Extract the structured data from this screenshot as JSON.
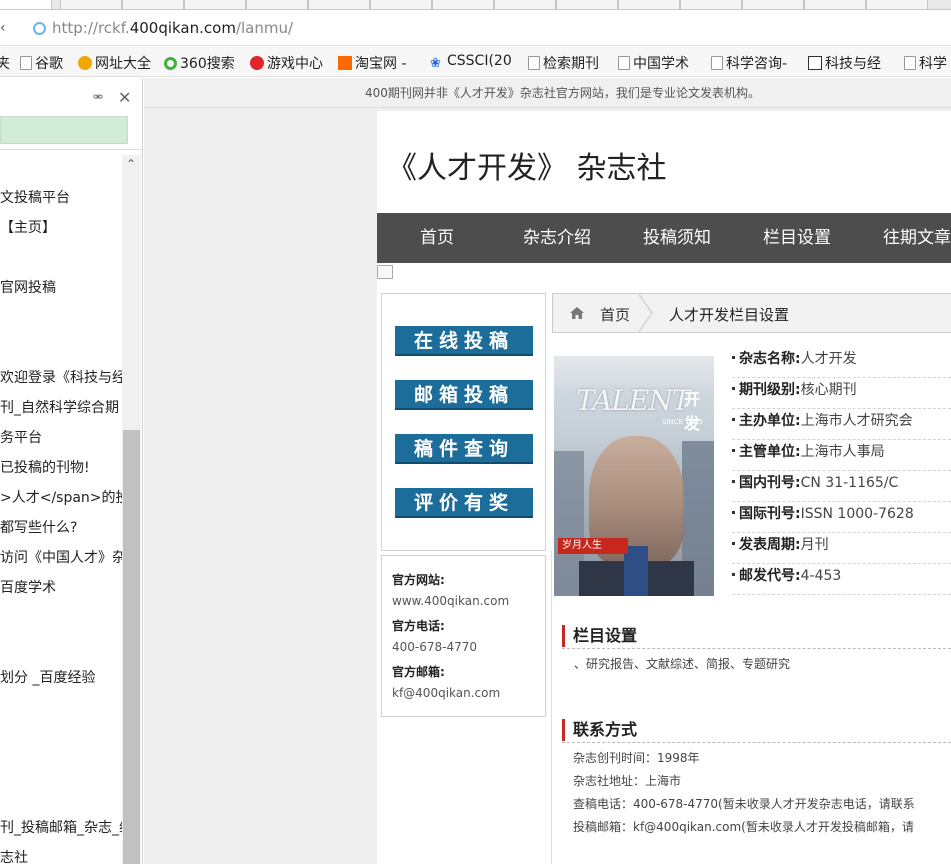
{
  "browser": {
    "address": {
      "prefix": "http://rckf.",
      "domain": "400qikan.com",
      "path": "/lanmu/"
    },
    "bookmarks": [
      {
        "label": "夹",
        "icon": "none"
      },
      {
        "label": "谷歌",
        "icon": "page-icon"
      },
      {
        "label": "网址大全",
        "icon": "hao123-icon"
      },
      {
        "label": "360搜索",
        "icon": "360-search-icon"
      },
      {
        "label": "游戏中心",
        "icon": "game-center-icon"
      },
      {
        "label": "淘宝网 -",
        "icon": "taobao-icon"
      },
      {
        "label": "CSSCI(20",
        "icon": "paw-icon"
      },
      {
        "label": "检索期刊",
        "icon": "page-icon"
      },
      {
        "label": "中国学术",
        "icon": "page-icon"
      },
      {
        "label": "科学咨询-",
        "icon": "page-icon"
      },
      {
        "label": "科技与经",
        "icon": "zhiwang-icon"
      },
      {
        "label": "科学",
        "icon": "page-icon"
      }
    ]
  },
  "sidebar": {
    "items": [
      "文投稿平台",
      "【主页】",
      "官网投稿",
      "欢迎登录《科技与经",
      "刊_自然科学综合期",
      "务平台",
      "已投稿的刊物!",
      ">人才</span>的投",
      "都写些什么?",
      "访问《中国人才》杂",
      "百度学术",
      "划分 _百度经验",
      "刊_投稿邮箱_杂志_组",
      "志社"
    ]
  },
  "page": {
    "notice": "400期刊网并非《人才开发》杂志社官方网站，我们是专业论文发表机构。",
    "title": "《人才开发》 杂志社",
    "nav": [
      "首页",
      "杂志介绍",
      "投稿须知",
      "栏目设置",
      "往期文章"
    ],
    "side_buttons": [
      "在线投稿",
      "邮箱投稿",
      "稿件查询",
      "评价有奖"
    ],
    "contact": {
      "website_label": "官方网站:",
      "website": "www.400qikan.com",
      "phone_label": "官方电话:",
      "phone": "400-678-4770",
      "email_label": "官方邮箱:",
      "email": "kf@400qikan.com"
    },
    "breadcrumb": {
      "home": "首页",
      "current": "人才开发栏目设置"
    },
    "cover": {
      "brand": "TALENT",
      "brand_cn": "开发",
      "since": "SINCE 1985",
      "banner": "岁月人生 "
    },
    "info": [
      {
        "label": "杂志名称:",
        "value": "人才开发"
      },
      {
        "label": "期刊级别:",
        "value": "核心期刊"
      },
      {
        "label": "主办单位:",
        "value": "上海市人才研究会"
      },
      {
        "label": "主管单位:",
        "value": "上海市人事局"
      },
      {
        "label": "国内刊号:",
        "value": "CN 31-1165/C"
      },
      {
        "label": "国际刊号:",
        "value": "ISSN 1000-7628"
      },
      {
        "label": "发表周期:",
        "value": "月刊"
      },
      {
        "label": "邮发代号:",
        "value": "4-453"
      }
    ],
    "columns_section": {
      "title": "栏目设置",
      "text": "、研究报告、文献综述、简报、专题研究"
    },
    "contact_section": {
      "title": "联系方式",
      "lines": [
        "杂志创刊时间：1998年",
        "杂志社地址：上海市",
        "查稿电话：400-678-4770(暂未收录人才开发杂志电话，请联系",
        "投稿邮箱：kf@400qikan.com(暂未收录人才开发投稿邮箱，请"
      ]
    }
  }
}
